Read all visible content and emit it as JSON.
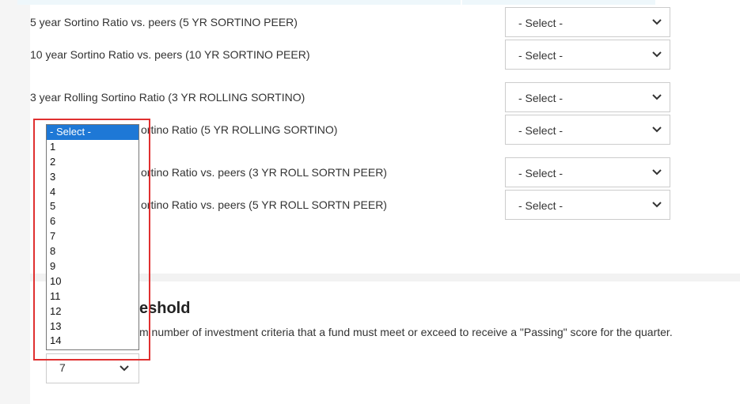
{
  "criteria": [
    {
      "label": "5 year Sortino Ratio vs. peers (5 YR SORTINO PEER)",
      "value": "- Select -"
    },
    {
      "label": "10 year Sortino Ratio vs. peers (10 YR SORTINO PEER)",
      "value": "- Select -"
    },
    {
      "label": "3 year Rolling Sortino Ratio (3 YR ROLLING SORTINO)",
      "value": "- Select -"
    },
    {
      "label": "ortino Ratio (5 YR ROLLING SORTINO)",
      "value": "- Select -"
    },
    {
      "label": "ortino Ratio vs. peers (3 YR ROLL SORTN PEER)",
      "value": "- Select -"
    },
    {
      "label": "ortino Ratio vs. peers (5 YR ROLL SORTN PEER)",
      "value": "- Select -"
    }
  ],
  "threshold": {
    "heading_fragment": "eshold",
    "description_fragment": "m number of investment criteria that a fund must meet or exceed to receive a \"Passing\" score for the quarter.",
    "selected_value": "7"
  },
  "dropdown_options": [
    "- Select -",
    "1",
    "2",
    "3",
    "4",
    "5",
    "6",
    "7",
    "8",
    "9",
    "10",
    "11",
    "12",
    "13",
    "14"
  ],
  "icons": {
    "chevron": "chevron-down-icon"
  },
  "colors": {
    "highlight": "#e03030",
    "selected_option": "#1e78d6"
  }
}
